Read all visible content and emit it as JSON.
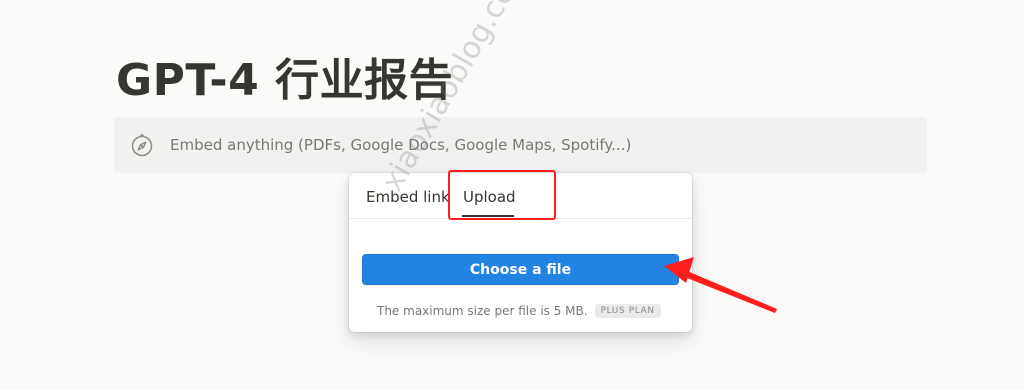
{
  "page": {
    "title": "GPT-4 行业报告"
  },
  "embed_block": {
    "icon": "compass-icon",
    "placeholder": "Embed anything (PDFs, Google Docs, Google Maps, Spotify...)"
  },
  "popover": {
    "tabs": [
      {
        "label": "Embed link",
        "active": false
      },
      {
        "label": "Upload",
        "active": true
      }
    ],
    "choose_button_label": "Choose a file",
    "size_note": "The maximum size per file is 5 MB.",
    "plan_badge": "PLUS PLAN"
  },
  "annotations": {
    "highlight_color": "#ff1e1e",
    "arrow_color": "#ff1e1e"
  },
  "watermark": "xiaoxiaoblog.com",
  "colors": {
    "background": "#fbfaf9",
    "embed_bg": "#f1f1ef",
    "button_blue": "#2383e2",
    "text_primary": "#37352f",
    "text_secondary": "#787774"
  }
}
